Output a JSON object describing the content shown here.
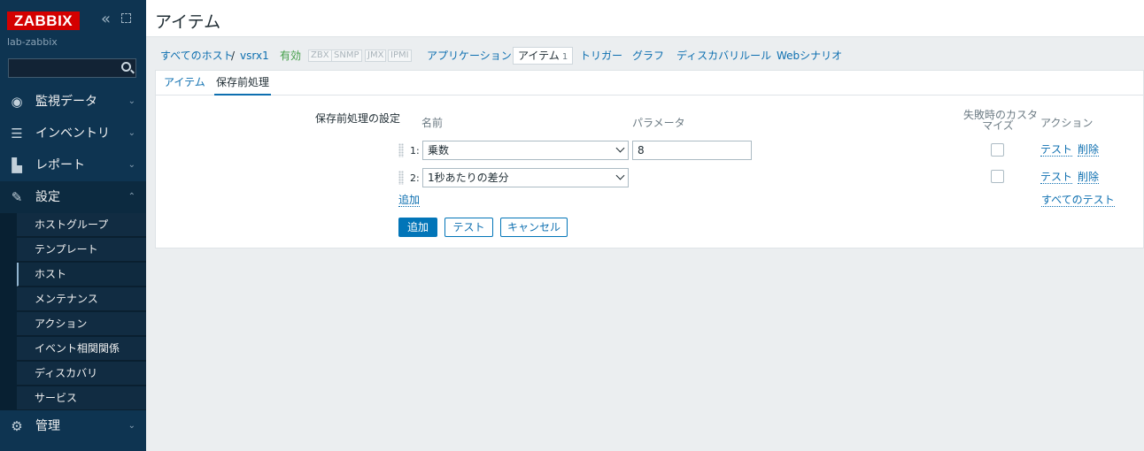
{
  "sidebar": {
    "logo": "ZABBIX",
    "server_name": "lab-zabbix",
    "search_value": "",
    "menu": {
      "monitoring": "監視データ",
      "inventory": "インベントリ",
      "reports": "レポート",
      "configuration": "設定",
      "administration": "管理"
    },
    "submenu": [
      "ホストグループ",
      "テンプレート",
      "ホスト",
      "メンテナンス",
      "アクション",
      "イベント相関関係",
      "ディスカバリ",
      "サービス"
    ]
  },
  "page": {
    "title": "アイテム"
  },
  "nav": {
    "all_hosts": "すべてのホスト",
    "separator": "/",
    "host": "vsrx1",
    "status": "有効",
    "protocols": [
      "ZBX",
      "SNMP",
      "JMX",
      "IPMI"
    ],
    "applications": "アプリケーション",
    "items": "アイテム",
    "items_count": "1",
    "triggers": "トリガー",
    "graphs": "グラフ",
    "discovery_rules": "ディスカバリルール",
    "web_scenarios": "Webシナリオ"
  },
  "tabs": {
    "item": "アイテム",
    "preprocessing": "保存前処理"
  },
  "form": {
    "section_label": "保存前処理の設定",
    "col_name": "名前",
    "col_params": "パラメータ",
    "col_custom_on_fail": "失敗時のカスタマイズ",
    "col_custom_on_fail_line1": "失敗時のカスタ",
    "col_custom_on_fail_line2": "マイズ",
    "col_actions": "アクション",
    "steps": [
      {
        "index": "1:",
        "name": "乗数",
        "param": "8",
        "custom_on_fail": false,
        "test": "テスト",
        "remove": "削除"
      },
      {
        "index": "2:",
        "name": "1秒あたりの差分",
        "param": "",
        "custom_on_fail": false,
        "test": "テスト",
        "remove": "削除"
      }
    ],
    "add_link": "追加",
    "test_all_link": "すべてのテスト"
  },
  "buttons": {
    "add": "追加",
    "test": "テスト",
    "cancel": "キャンセル"
  }
}
